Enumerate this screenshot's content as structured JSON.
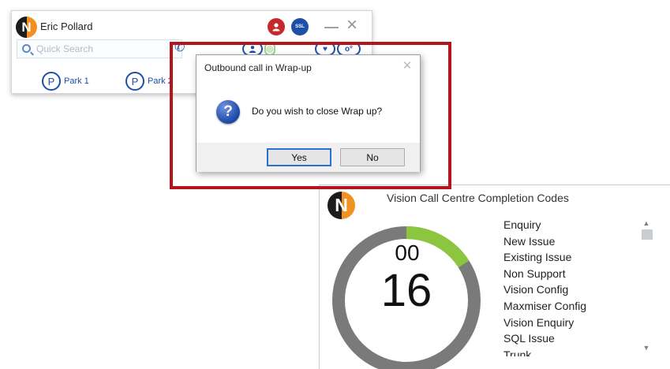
{
  "phonebar": {
    "user_name": "Eric Pollard",
    "status_badge": "SSL",
    "search_placeholder": "Quick Search",
    "park_1": "Park 1",
    "park_2": "Park 2",
    "park_icon_letter": "P"
  },
  "dialog": {
    "title": "Outbound call in Wrap-up",
    "message": "Do you wish to close Wrap up?",
    "yes_label": "Yes",
    "no_label": "No",
    "icon": "question-icon"
  },
  "codes_panel": {
    "title": "Vision Call Centre Completion Codes",
    "logo_letter": "N",
    "timer_top": "00",
    "timer_main": "16",
    "timer_progress_fraction": 0.16,
    "codes": [
      "Enquiry",
      "New Issue",
      "Existing Issue",
      "Non Support",
      "Vision Config",
      "Maxmiser Config",
      "Vision Enquiry",
      "SQL Issue",
      "Trunk"
    ]
  },
  "colors": {
    "highlight": "#b4141b",
    "timer_progress": "#8cc63f",
    "timer_track": "#7a7a7a",
    "brand_blue": "#1d4fa8",
    "brand_orange": "#f29022"
  }
}
